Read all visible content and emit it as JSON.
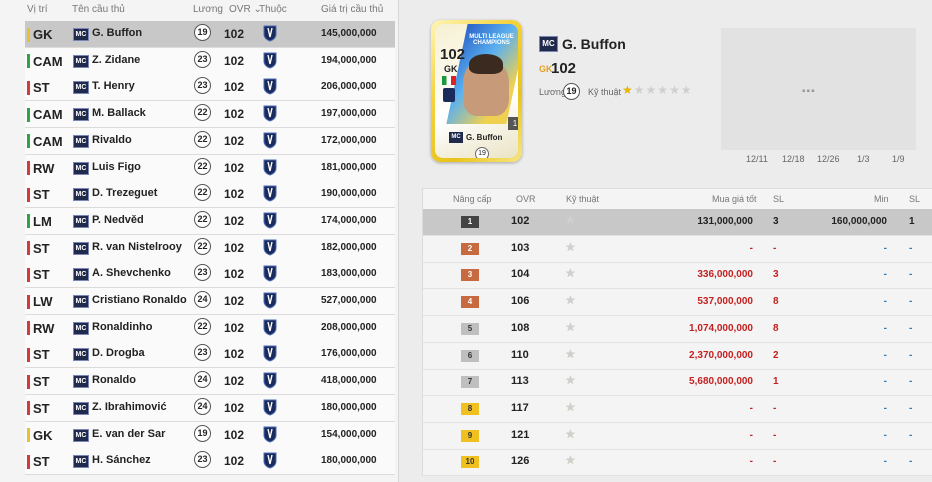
{
  "list_header": {
    "position": "Vị trí",
    "name": "Tên cầu thủ",
    "wage": "Lương",
    "ovr": "OVR",
    "club": "Thuộc",
    "value": "Giá trị cầu thủ"
  },
  "players": [
    {
      "pos": "GK",
      "color": "#e8c030",
      "name": "G. Buffon",
      "wage": "19",
      "ovr": "102",
      "value": "145,000,000"
    },
    {
      "pos": "CAM",
      "color": "#2fa24b",
      "name": "Z. Zidane",
      "wage": "23",
      "ovr": "102",
      "value": "194,000,000"
    },
    {
      "pos": "ST",
      "color": "#d33a3a",
      "name": "T. Henry",
      "wage": "23",
      "ovr": "102",
      "value": "206,000,000"
    },
    {
      "pos": "CAM",
      "color": "#2fa24b",
      "name": "M. Ballack",
      "wage": "22",
      "ovr": "102",
      "value": "197,000,000"
    },
    {
      "pos": "CAM",
      "color": "#2fa24b",
      "name": "Rivaldo",
      "wage": "22",
      "ovr": "102",
      "value": "172,000,000"
    },
    {
      "pos": "RW",
      "color": "#d33a3a",
      "name": "Luis Figo",
      "wage": "22",
      "ovr": "102",
      "value": "181,000,000"
    },
    {
      "pos": "ST",
      "color": "#d33a3a",
      "name": "D. Trezeguet",
      "wage": "22",
      "ovr": "102",
      "value": "190,000,000"
    },
    {
      "pos": "LM",
      "color": "#2fa24b",
      "name": "P. Nedvěd",
      "wage": "22",
      "ovr": "102",
      "value": "174,000,000"
    },
    {
      "pos": "ST",
      "color": "#d33a3a",
      "name": "R. van Nistelrooy",
      "wage": "22",
      "ovr": "102",
      "value": "182,000,000"
    },
    {
      "pos": "ST",
      "color": "#d33a3a",
      "name": "A. Shevchenko",
      "wage": "23",
      "ovr": "102",
      "value": "183,000,000"
    },
    {
      "pos": "LW",
      "color": "#d33a3a",
      "name": "Cristiano Ronaldo",
      "wage": "24",
      "ovr": "102",
      "value": "527,000,000"
    },
    {
      "pos": "RW",
      "color": "#d33a3a",
      "name": "Ronaldinho",
      "wage": "22",
      "ovr": "102",
      "value": "208,000,000"
    },
    {
      "pos": "ST",
      "color": "#d33a3a",
      "name": "D. Drogba",
      "wage": "23",
      "ovr": "102",
      "value": "176,000,000"
    },
    {
      "pos": "ST",
      "color": "#d33a3a",
      "name": "Ronaldo",
      "wage": "24",
      "ovr": "102",
      "value": "418,000,000"
    },
    {
      "pos": "ST",
      "color": "#d33a3a",
      "name": "Z. Ibrahimović",
      "wage": "24",
      "ovr": "102",
      "value": "180,000,000"
    },
    {
      "pos": "GK",
      "color": "#e8c030",
      "name": "E. van der Sar",
      "wage": "19",
      "ovr": "102",
      "value": "154,000,000"
    },
    {
      "pos": "ST",
      "color": "#d33a3a",
      "name": "H. Sánchez",
      "wage": "23",
      "ovr": "102",
      "value": "180,000,000"
    }
  ],
  "card": {
    "ovr": "102",
    "pos": "GK",
    "league_line1": "MULTI LEAGUE",
    "league_line2": "CHAMPIONS",
    "level": "1",
    "season": "MC",
    "name": "G. Buffon",
    "wage": "19"
  },
  "info": {
    "season": "MC",
    "name": "G. Buffon",
    "pos": "GK",
    "ovr": "102",
    "wage_label": "Lương",
    "wage": "19",
    "skill_label": "Kỹ thuật",
    "skill_stars": 1
  },
  "graph": {
    "dates": [
      "12/11",
      "12/18",
      "12/26",
      "1/3",
      "1/9"
    ],
    "placeholder": "▪▪▪"
  },
  "upgrade_header": {
    "level": "Nâng cấp",
    "ovr": "OVR",
    "skill": "Kỹ thuật",
    "buy": "Mua giá tốt",
    "sl": "SL",
    "min": "Min",
    "sl2": "SL"
  },
  "upgrades": [
    {
      "level": "1",
      "lvl_bg": "#444444",
      "lvl_fg": "#ffffff",
      "ovr": "102",
      "stars": 1,
      "buy": "131,000,000",
      "buy_color": "#222222",
      "sl": "3",
      "sl_color": "#222222",
      "min": "160,000,000",
      "min_color": "#222222",
      "sl2": "1",
      "sl2_color": "#222222"
    },
    {
      "level": "2",
      "lvl_bg": "#c86a40",
      "lvl_fg": "#ffffff",
      "ovr": "103",
      "stars": 1,
      "buy": "-",
      "buy_color": "#c42020",
      "sl": "-",
      "sl_color": "#c42020",
      "min": "-",
      "min_color": "#2a7ab8",
      "sl2": "-",
      "sl2_color": "#2a7ab8"
    },
    {
      "level": "3",
      "lvl_bg": "#c86a40",
      "lvl_fg": "#ffffff",
      "ovr": "104",
      "stars": 1,
      "buy": "336,000,000",
      "buy_color": "#c42020",
      "sl": "3",
      "sl_color": "#c42020",
      "min": "-",
      "min_color": "#2a7ab8",
      "sl2": "-",
      "sl2_color": "#2a7ab8"
    },
    {
      "level": "4",
      "lvl_bg": "#c86a40",
      "lvl_fg": "#ffffff",
      "ovr": "106",
      "stars": 1,
      "buy": "537,000,000",
      "buy_color": "#c42020",
      "sl": "8",
      "sl_color": "#c42020",
      "min": "-",
      "min_color": "#2a7ab8",
      "sl2": "-",
      "sl2_color": "#2a7ab8"
    },
    {
      "level": "5",
      "lvl_bg": "#bfbfbf",
      "lvl_fg": "#333333",
      "ovr": "108",
      "stars": 2,
      "buy": "1,074,000,000",
      "buy_color": "#c42020",
      "sl": "8",
      "sl_color": "#c42020",
      "min": "-",
      "min_color": "#2a7ab8",
      "sl2": "-",
      "sl2_color": "#2a7ab8"
    },
    {
      "level": "6",
      "lvl_bg": "#bfbfbf",
      "lvl_fg": "#333333",
      "ovr": "110",
      "stars": 2,
      "buy": "2,370,000,000",
      "buy_color": "#c42020",
      "sl": "2",
      "sl_color": "#c42020",
      "min": "-",
      "min_color": "#2a7ab8",
      "sl2": "-",
      "sl2_color": "#2a7ab8"
    },
    {
      "level": "7",
      "lvl_bg": "#bfbfbf",
      "lvl_fg": "#333333",
      "ovr": "113",
      "stars": 2,
      "buy": "5,680,000,000",
      "buy_color": "#c42020",
      "sl": "1",
      "sl_color": "#c42020",
      "min": "-",
      "min_color": "#2a7ab8",
      "sl2": "-",
      "sl2_color": "#2a7ab8"
    },
    {
      "level": "8",
      "lvl_bg": "#f0c020",
      "lvl_fg": "#333333",
      "ovr": "117",
      "stars": 3,
      "buy": "-",
      "buy_color": "#c42020",
      "sl": "-",
      "sl_color": "#c42020",
      "min": "-",
      "min_color": "#2a7ab8",
      "sl2": "-",
      "sl2_color": "#2a7ab8"
    },
    {
      "level": "9",
      "lvl_bg": "#f0c020",
      "lvl_fg": "#333333",
      "ovr": "121",
      "stars": 3,
      "buy": "-",
      "buy_color": "#c42020",
      "sl": "-",
      "sl_color": "#c42020",
      "min": "-",
      "min_color": "#2a7ab8",
      "sl2": "-",
      "sl2_color": "#2a7ab8"
    },
    {
      "level": "10",
      "lvl_bg": "#f0c020",
      "lvl_fg": "#333333",
      "ovr": "126",
      "stars": 3,
      "buy": "-",
      "buy_color": "#c42020",
      "sl": "-",
      "sl_color": "#c42020",
      "min": "-",
      "min_color": "#2a7ab8",
      "sl2": "-",
      "sl2_color": "#2a7ab8"
    }
  ]
}
